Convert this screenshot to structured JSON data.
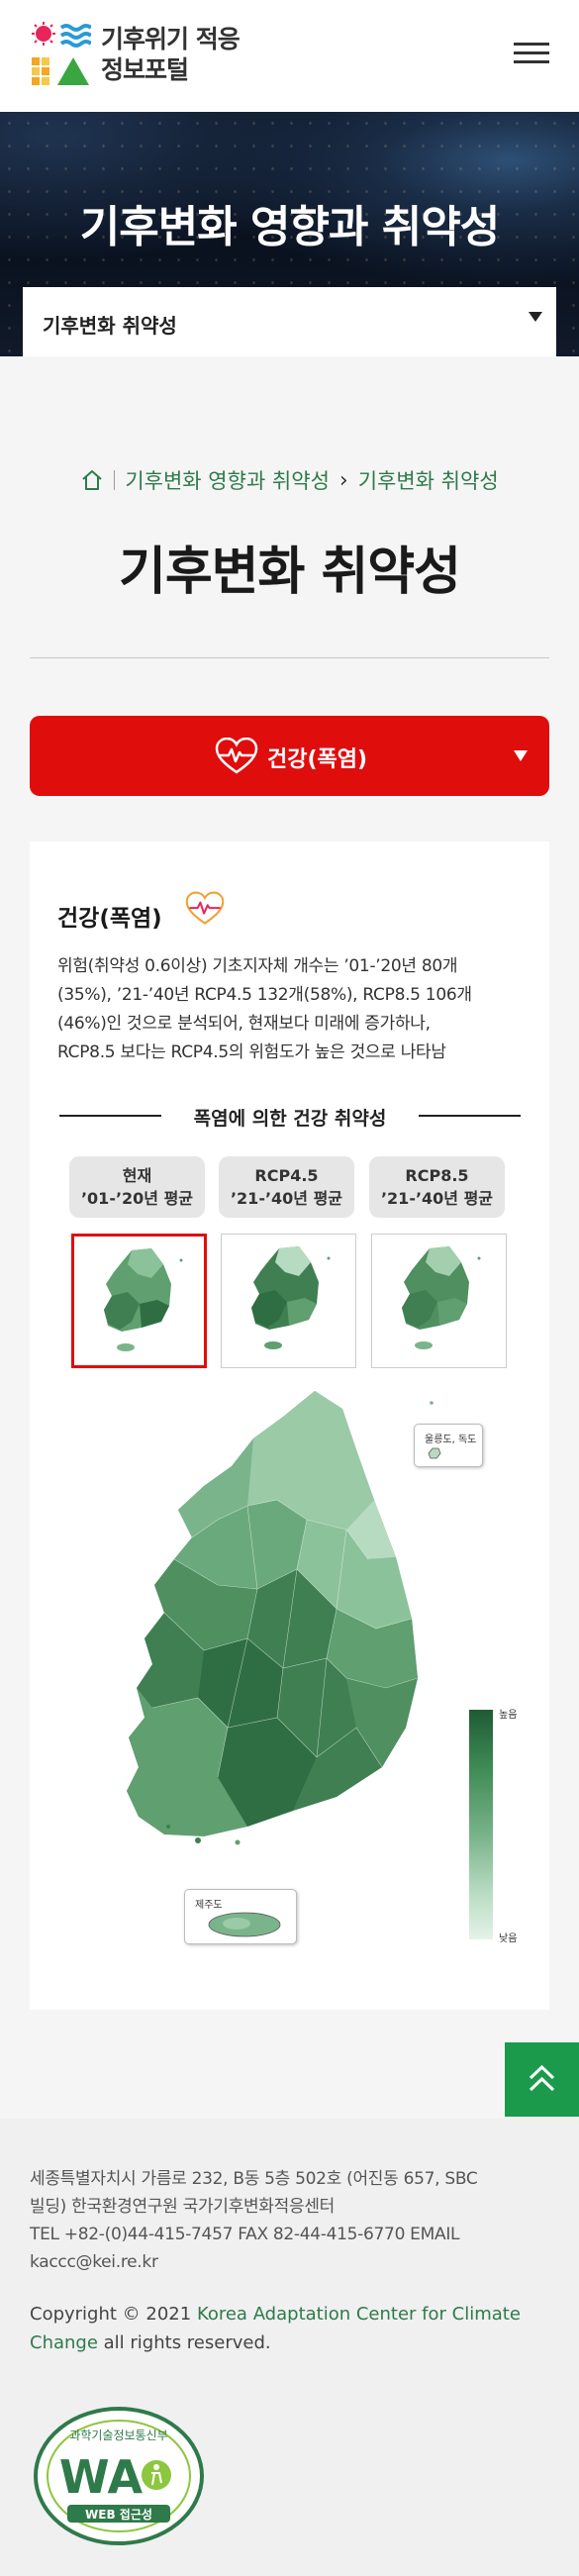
{
  "header": {
    "logo_line1": "기후위기 적응",
    "logo_line2": "정보포털"
  },
  "banner": {
    "title": "기후변화 영향과 취약성",
    "subnav_selected": "기후변화 취약성"
  },
  "breadcrumb": {
    "items": [
      "기후변화 영향과 취약성",
      "기후변화 취약성"
    ]
  },
  "page": {
    "title": "기후변화 취약성",
    "category_selected": "건강(폭염)"
  },
  "card": {
    "heading": "건강(폭염)",
    "description_lines": [
      "위험(취약성 0.6이상) 기초지자체 개수는 ’01-’20년 80개",
      "(35%), ’21-’40년 RCP4.5 132개(58%), RCP8.5 106개",
      "(46%)인 것으로 분석되어, 현재보다 미래에 증가하나,",
      "RCP8.5 보다는 RCP4.5의 위험도가 높은 것으로 나타남"
    ],
    "section_title": "폭염에 의한 건강 취약성",
    "tabs": [
      {
        "line1": "현재",
        "line2": "’01-’20년 평균"
      },
      {
        "line1": "RCP4.5",
        "line2": "’21-’40년 평균"
      },
      {
        "line1": "RCP8.5",
        "line2": "’21-’40년 평균"
      }
    ],
    "active_tab": 0,
    "map_popup_ulleung": "울릉도, 독도",
    "map_popup_jeju": "제주도",
    "legend_high": "높음",
    "legend_low": "낮음",
    "colors": {
      "map_dark": "#2f6e43",
      "map_mid": "#5f9f70",
      "map_light": "#b7dbc0",
      "accent_red": "#e00d0d",
      "accent_green": "#1c9a4c"
    }
  },
  "footer": {
    "address_line1": "세종특별자치시 가름로 232, B동 5층 502호 (어진동 657, SBC",
    "address_line2": "빌딩) 한국환경연구원 국가기후변화적응센터",
    "address_line3": "TEL +82-(0)44-415-7457 FAX 82-44-415-6770 EMAIL",
    "address_line4": "kaccc@kei.re.kr",
    "copyright_prefix": "Copyright © 2021 ",
    "copyright_link_line1": "Korea Adaptation Center for Climate",
    "copyright_link_line2": "Change",
    "copyright_suffix": " all rights reserved.",
    "wa_top_text": "과학기술정보통신부",
    "wa_mark": "WA",
    "wa_bottom_text": "WEB 접근성"
  }
}
